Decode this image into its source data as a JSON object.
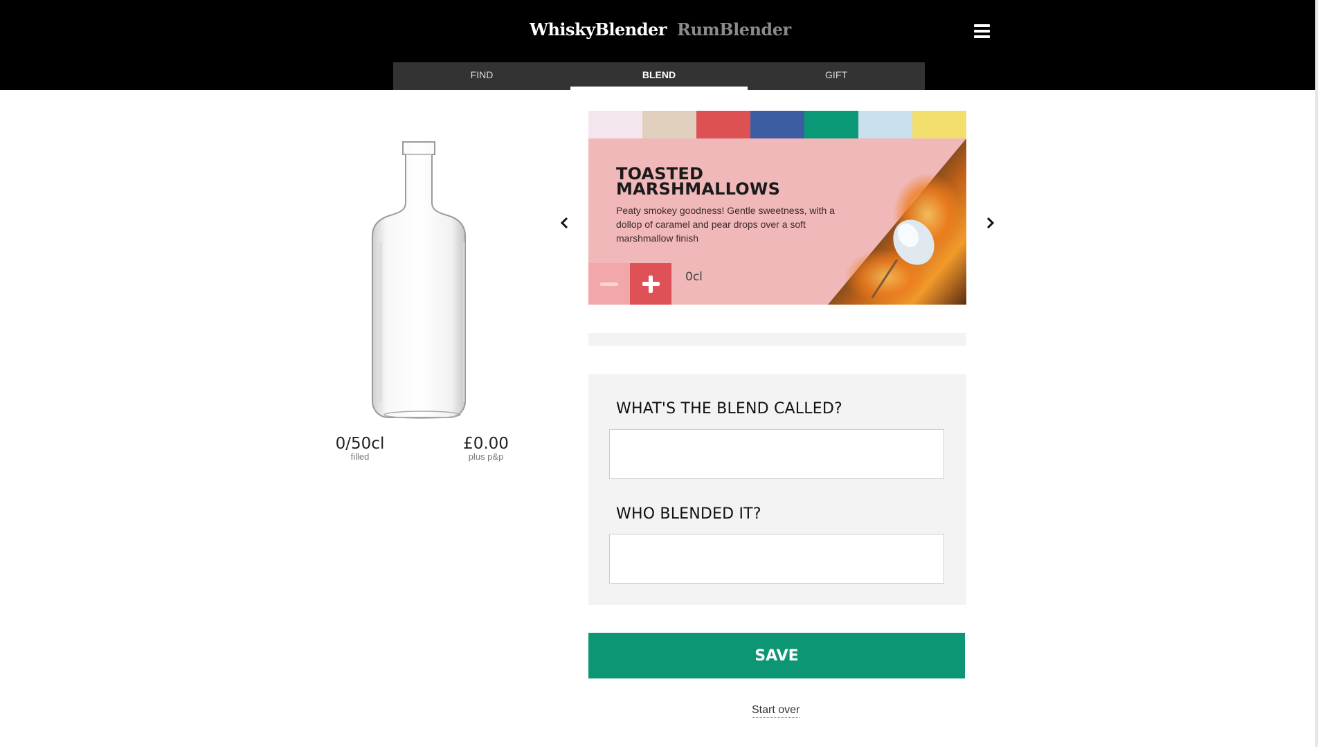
{
  "header": {
    "brand_primary": "WhiskyBlender",
    "brand_secondary": "RumBlender",
    "menu_icon": "hamburger-icon",
    "tabs": [
      {
        "label": "FIND"
      },
      {
        "label": "BLEND"
      },
      {
        "label": "GIFT"
      }
    ],
    "active_tab": "BLEND"
  },
  "bottle": {
    "filled_value": "0/50cl",
    "filled_caption": "filled",
    "price_value": "£0.00",
    "price_caption": "plus p&p"
  },
  "flavour_swatches": [
    "#f4e6ee",
    "#e0cfbd",
    "#dd5153",
    "#3c5da2",
    "#0a9a78",
    "#c9e0ef",
    "#f2de6d"
  ],
  "flavour_card": {
    "title": "TOASTED MARSHMALLOWS",
    "description": "Peaty smokey goodness! Gentle sweetness, with a dollop of caramel and pear drops over a soft marshmallow finish",
    "amount": "0cl",
    "minus_icon": "minus-icon",
    "plus_icon": "plus-icon",
    "background_color": "#f0b8b9"
  },
  "carousel": {
    "prev_icon": "chevron-left-icon",
    "next_icon": "chevron-right-icon"
  },
  "form": {
    "name_label": "WHAT'S THE BLEND CALLED?",
    "name_value": "",
    "blender_label": "WHO BLENDED IT?",
    "blender_value": ""
  },
  "actions": {
    "save_label": "SAVE",
    "start_over_label": "Start over",
    "save_color": "#0c9673"
  }
}
